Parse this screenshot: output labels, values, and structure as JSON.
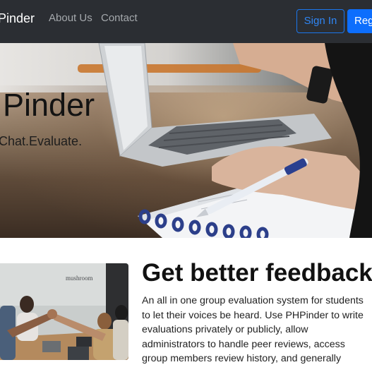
{
  "navbar": {
    "brand": "Pinder",
    "links": [
      "About Us",
      "Contact"
    ],
    "signin_label": "Sign In",
    "register_label": "Reg"
  },
  "hero": {
    "title": "Pinder",
    "tagline": "Chat.Evaluate.",
    "sign_text": "mushroom"
  },
  "feature": {
    "title": "Get better feedback",
    "text": "An all in one group evaluation system for students to let their voices be heard. Use PHPinder to write evaluations privately or publicly, allow administrators to handle peer reviews, access group members review history, and generally"
  },
  "colors": {
    "navbar_bg": "#2b2e33",
    "primary": "#0d6efd",
    "nav_link": "#a5a9ad"
  }
}
